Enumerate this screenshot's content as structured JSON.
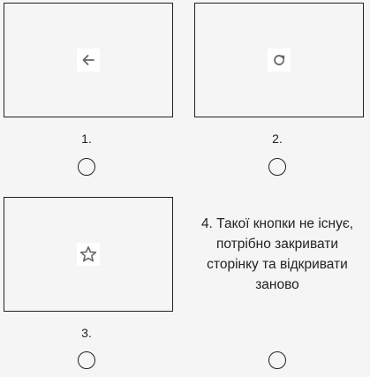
{
  "options": [
    {
      "number": "1.",
      "icon": "arrow-left-icon"
    },
    {
      "number": "2.",
      "icon": "reload-icon"
    },
    {
      "number": "3.",
      "icon": "star-icon"
    },
    {
      "text": "4. Такої кнопки не існує, потрібно закривати сторінку та відкривати заново"
    }
  ]
}
